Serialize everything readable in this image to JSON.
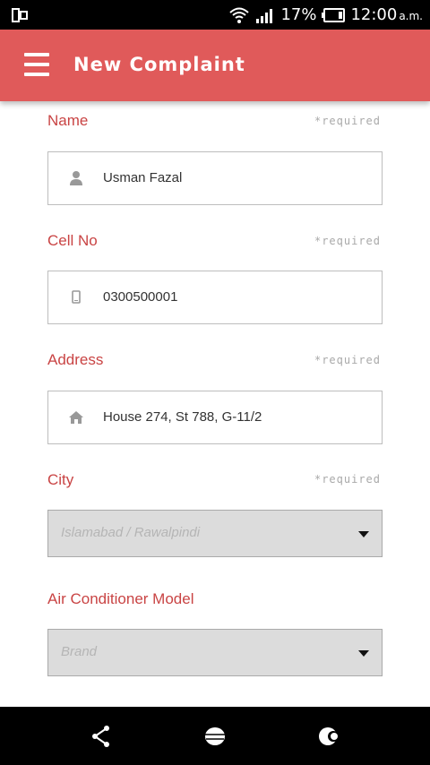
{
  "status_bar": {
    "battery": "17%",
    "time": "12:00",
    "ampm": "a.m."
  },
  "app_bar": {
    "title": "New Complaint"
  },
  "form": {
    "name": {
      "label": "Name",
      "required": "*required",
      "value": "Usman Fazal"
    },
    "cell": {
      "label": "Cell No",
      "required": "*required",
      "value": "0300500001"
    },
    "address": {
      "label": "Address",
      "required": "*required",
      "value": "House 274, St 788, G-11/2"
    },
    "city": {
      "label": "City",
      "required": "*required",
      "placeholder": "Islamabad / Rawalpindi"
    },
    "ac_model": {
      "label": "Air Conditioner Model",
      "placeholder": "Brand"
    }
  },
  "colors": {
    "accent": "#e05a5a",
    "label": "#c94444"
  }
}
